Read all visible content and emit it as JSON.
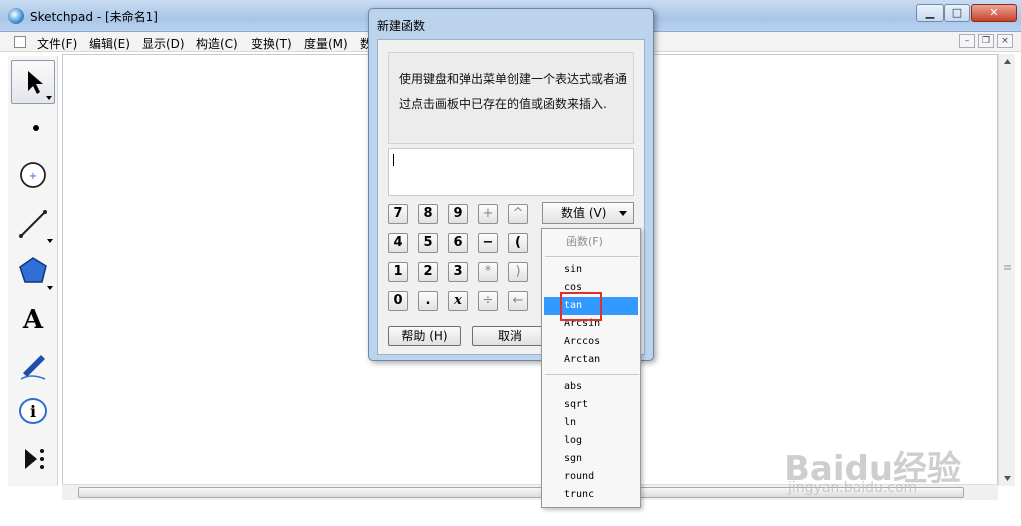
{
  "app": {
    "title": "Sketchpad - [未命名1]"
  },
  "window_controls": {
    "minimize": "▁",
    "maximize": "□",
    "close": "✕"
  },
  "menu": [
    "文件(F)",
    "编辑(E)",
    "显示(D)",
    "构造(C)",
    "变换(T)",
    "度量(M)",
    "数"
  ],
  "mdi_controls": {
    "minimize": "–",
    "restore": "❐",
    "close": "×"
  },
  "tools": [
    "select-arrow-icon",
    "point-icon",
    "compass-icon",
    "segment-icon",
    "polygon-icon",
    "text-tool-icon",
    "marker-icon",
    "information-icon",
    "custom-tool-icon"
  ],
  "dialog": {
    "title": "新建函数",
    "description_line1": "使用键盘和弹出菜单创建一个表达式或者通",
    "description_line2": "过点击画板中已存在的值或函数来插入.",
    "keypad": {
      "row1": [
        "7",
        "8",
        "9",
        "+",
        "^"
      ],
      "row2": [
        "4",
        "5",
        "6",
        "−",
        "("
      ],
      "row3": [
        "1",
        "2",
        "3",
        "*",
        ")"
      ],
      "row4": [
        "0",
        ".",
        "x",
        "÷",
        "←"
      ]
    },
    "values_button": "数值 (V)",
    "help_button": "帮助 (H)",
    "cancel_button": "取消"
  },
  "popup_menu": {
    "header": "函数(F)",
    "group1": [
      "sin",
      "cos",
      "tan",
      "Arcsin",
      "Arccos",
      "Arctan"
    ],
    "group2": [
      "abs",
      "sqrt",
      "ln",
      "log",
      "sgn",
      "round",
      "trunc"
    ],
    "highlighted": "tan"
  },
  "watermark": {
    "brand": "Baidu经验",
    "url": "jingyan.baidu.com"
  },
  "colors": {
    "highlight": "#3399ff",
    "annotation_box": "#e0302a",
    "dialog_frame": "#bcd3ec"
  }
}
